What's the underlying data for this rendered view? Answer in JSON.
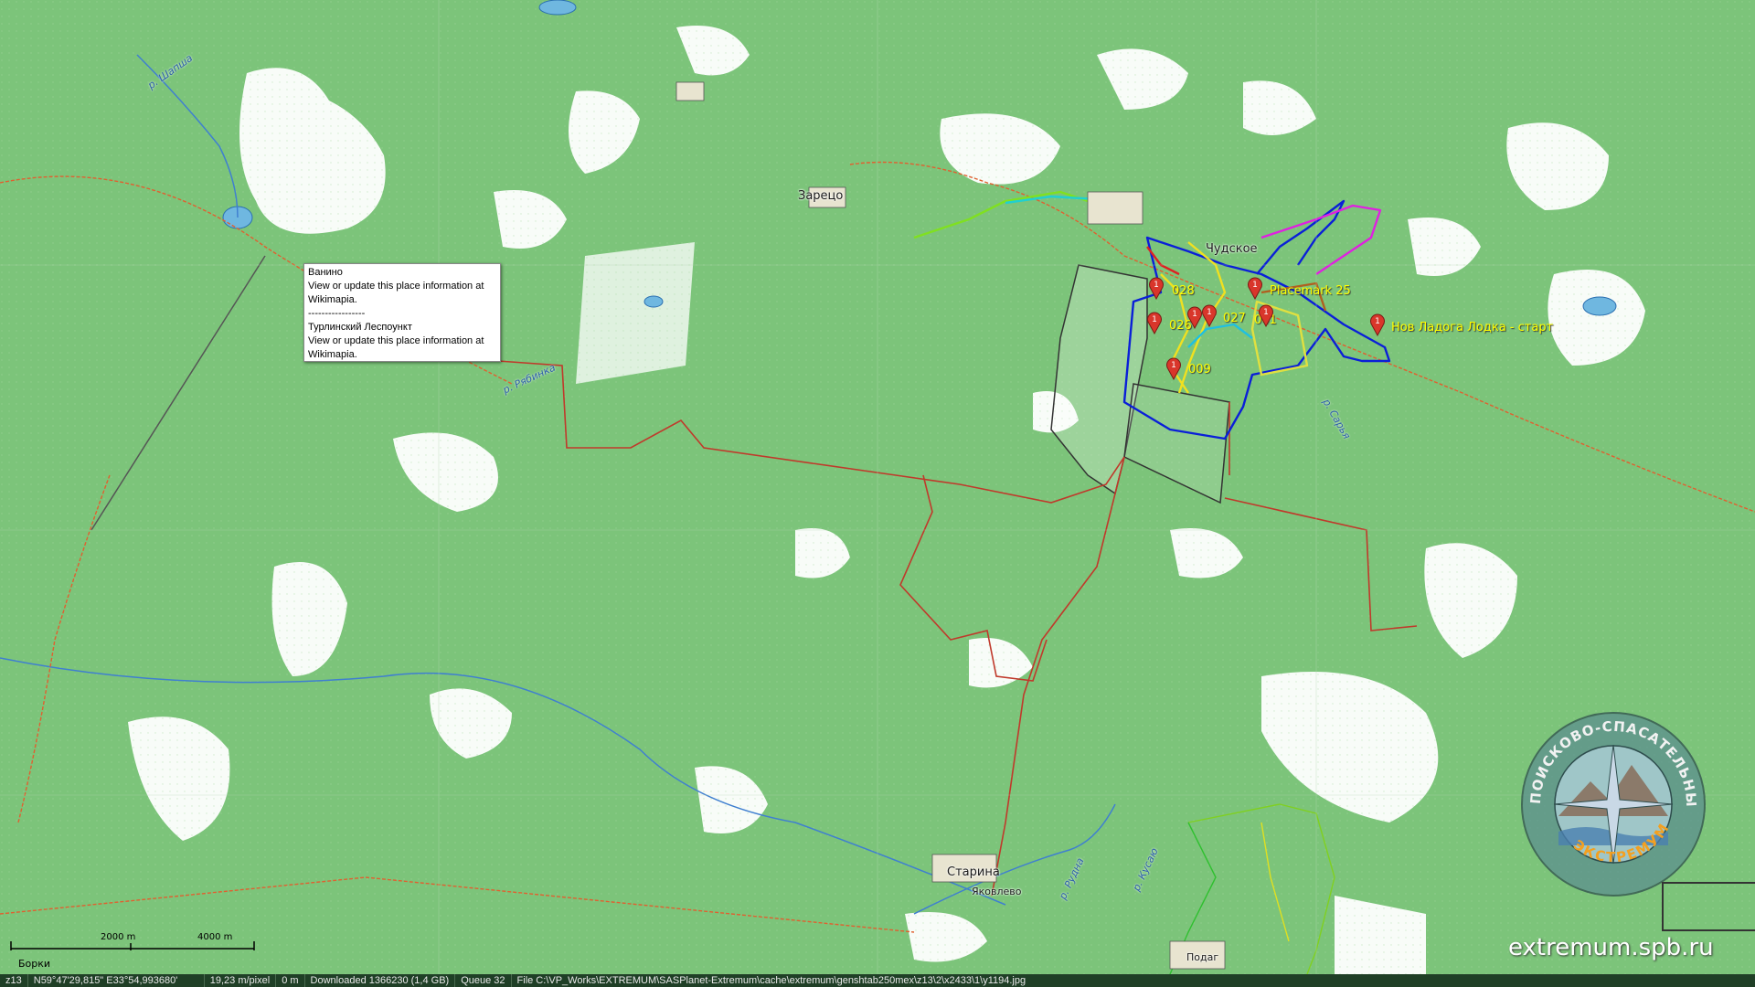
{
  "colors": {
    "forest": "#7cc47a",
    "clearing": "#ffffff",
    "route_red": "#c0392b",
    "track_blue": "#0a1fd8",
    "track_yellow": "#f0e020",
    "track_magenta": "#e020e0",
    "track_green": "#2aa02a",
    "placemark_red": "#d9362b",
    "status_bg": "#1f3f26"
  },
  "map": {
    "settlements": [
      "Зарецо",
      "Чудское",
      "Старина",
      "Яковлево",
      "Подаг"
    ],
    "rivers": [
      "р. Шапша",
      "р. Рябинка",
      "р. Сарья",
      "р. Рудна",
      "р. Кусаю"
    ],
    "placemarks": {
      "p028": "028",
      "p025": "Placemark 25",
      "p026": "026",
      "p027": "027",
      "p009": "009",
      "p041": "041",
      "start": "Нов Ладога Лодка - старт"
    }
  },
  "popup": {
    "line1": "Ванино",
    "line2": "View or update this place information at",
    "line3": "Wikimapia.",
    "separator": "-----------------",
    "line4": "Турлинский Леспоункт",
    "line5": "View or update this place information at",
    "line6": "Wikimapia."
  },
  "scale": {
    "left": "2000 m",
    "right": "4000 m",
    "place": "Борки"
  },
  "status": {
    "zoom": "z13",
    "coords": "N59°47'29,815\" E33°54,993680'",
    "resolution": "19,23 m/pixel",
    "distance": "0 m",
    "downloaded": "Downloaded 1366230 (1,4 GB)",
    "queue": "Queue 32",
    "file": "File C:\\VP_Works\\EXTREMUM\\SASPlanet-Extremum\\cache\\extremum\\genshtab250mex\\z13\\2\\x2433\\1\\y1194.jpg"
  },
  "watermark": {
    "site": "extremum.spb.ru",
    "logo_ring_top": "ПОИСКОВО-СПАСАТЕЛЬНЫЙ ОТРЯД",
    "logo_ring_bottom": "ЭКСТРЕМУМ"
  }
}
